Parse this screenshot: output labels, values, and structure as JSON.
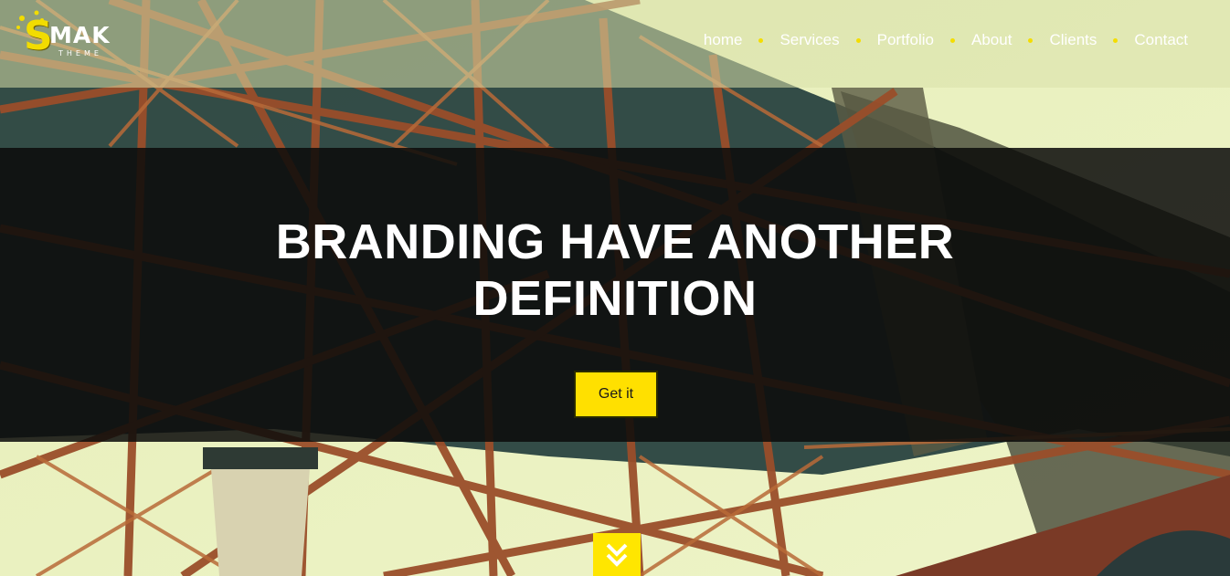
{
  "header": {
    "logo": {
      "mark": "S",
      "name": "MAK",
      "tagline": "THEME"
    },
    "nav": [
      "home",
      "Services",
      "Portfolio",
      "About",
      "Clients",
      "Contact"
    ]
  },
  "hero": {
    "headline_line1": "BRANDING HAVE ANOTHER",
    "headline_line2": "DEFINITION",
    "cta_label": "Get it"
  },
  "icons": {
    "scroll": "double-chevron-down-icon",
    "nav_separator": "dot-icon"
  },
  "colors": {
    "accent": "#ffe000",
    "banner": "#0c0c0a",
    "girder": "#8a4a2a",
    "sky": "#e8f0c0"
  }
}
